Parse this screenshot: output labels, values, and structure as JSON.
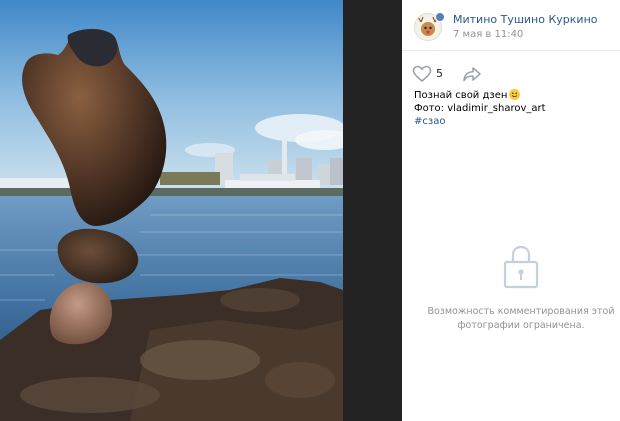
{
  "post": {
    "group_name": "Митино Тушино Куркино",
    "date": "7 мая в 11:40",
    "likes": "5",
    "text_line1": "Познай свой дзен",
    "text_line2": "Фото: vladimir_sharov_art",
    "hashtag": "#сзао"
  },
  "icons": {
    "like": "heart-icon",
    "share": "share-arrow-icon",
    "lock": "lock-icon",
    "emoji": "smiling-face-emoji"
  },
  "comments": {
    "restricted_text": "Возможность комментирования этой фотографии ограничена."
  },
  "colors": {
    "link": "#2a5885",
    "muted": "#939393",
    "viewer_bg": "#222222"
  }
}
